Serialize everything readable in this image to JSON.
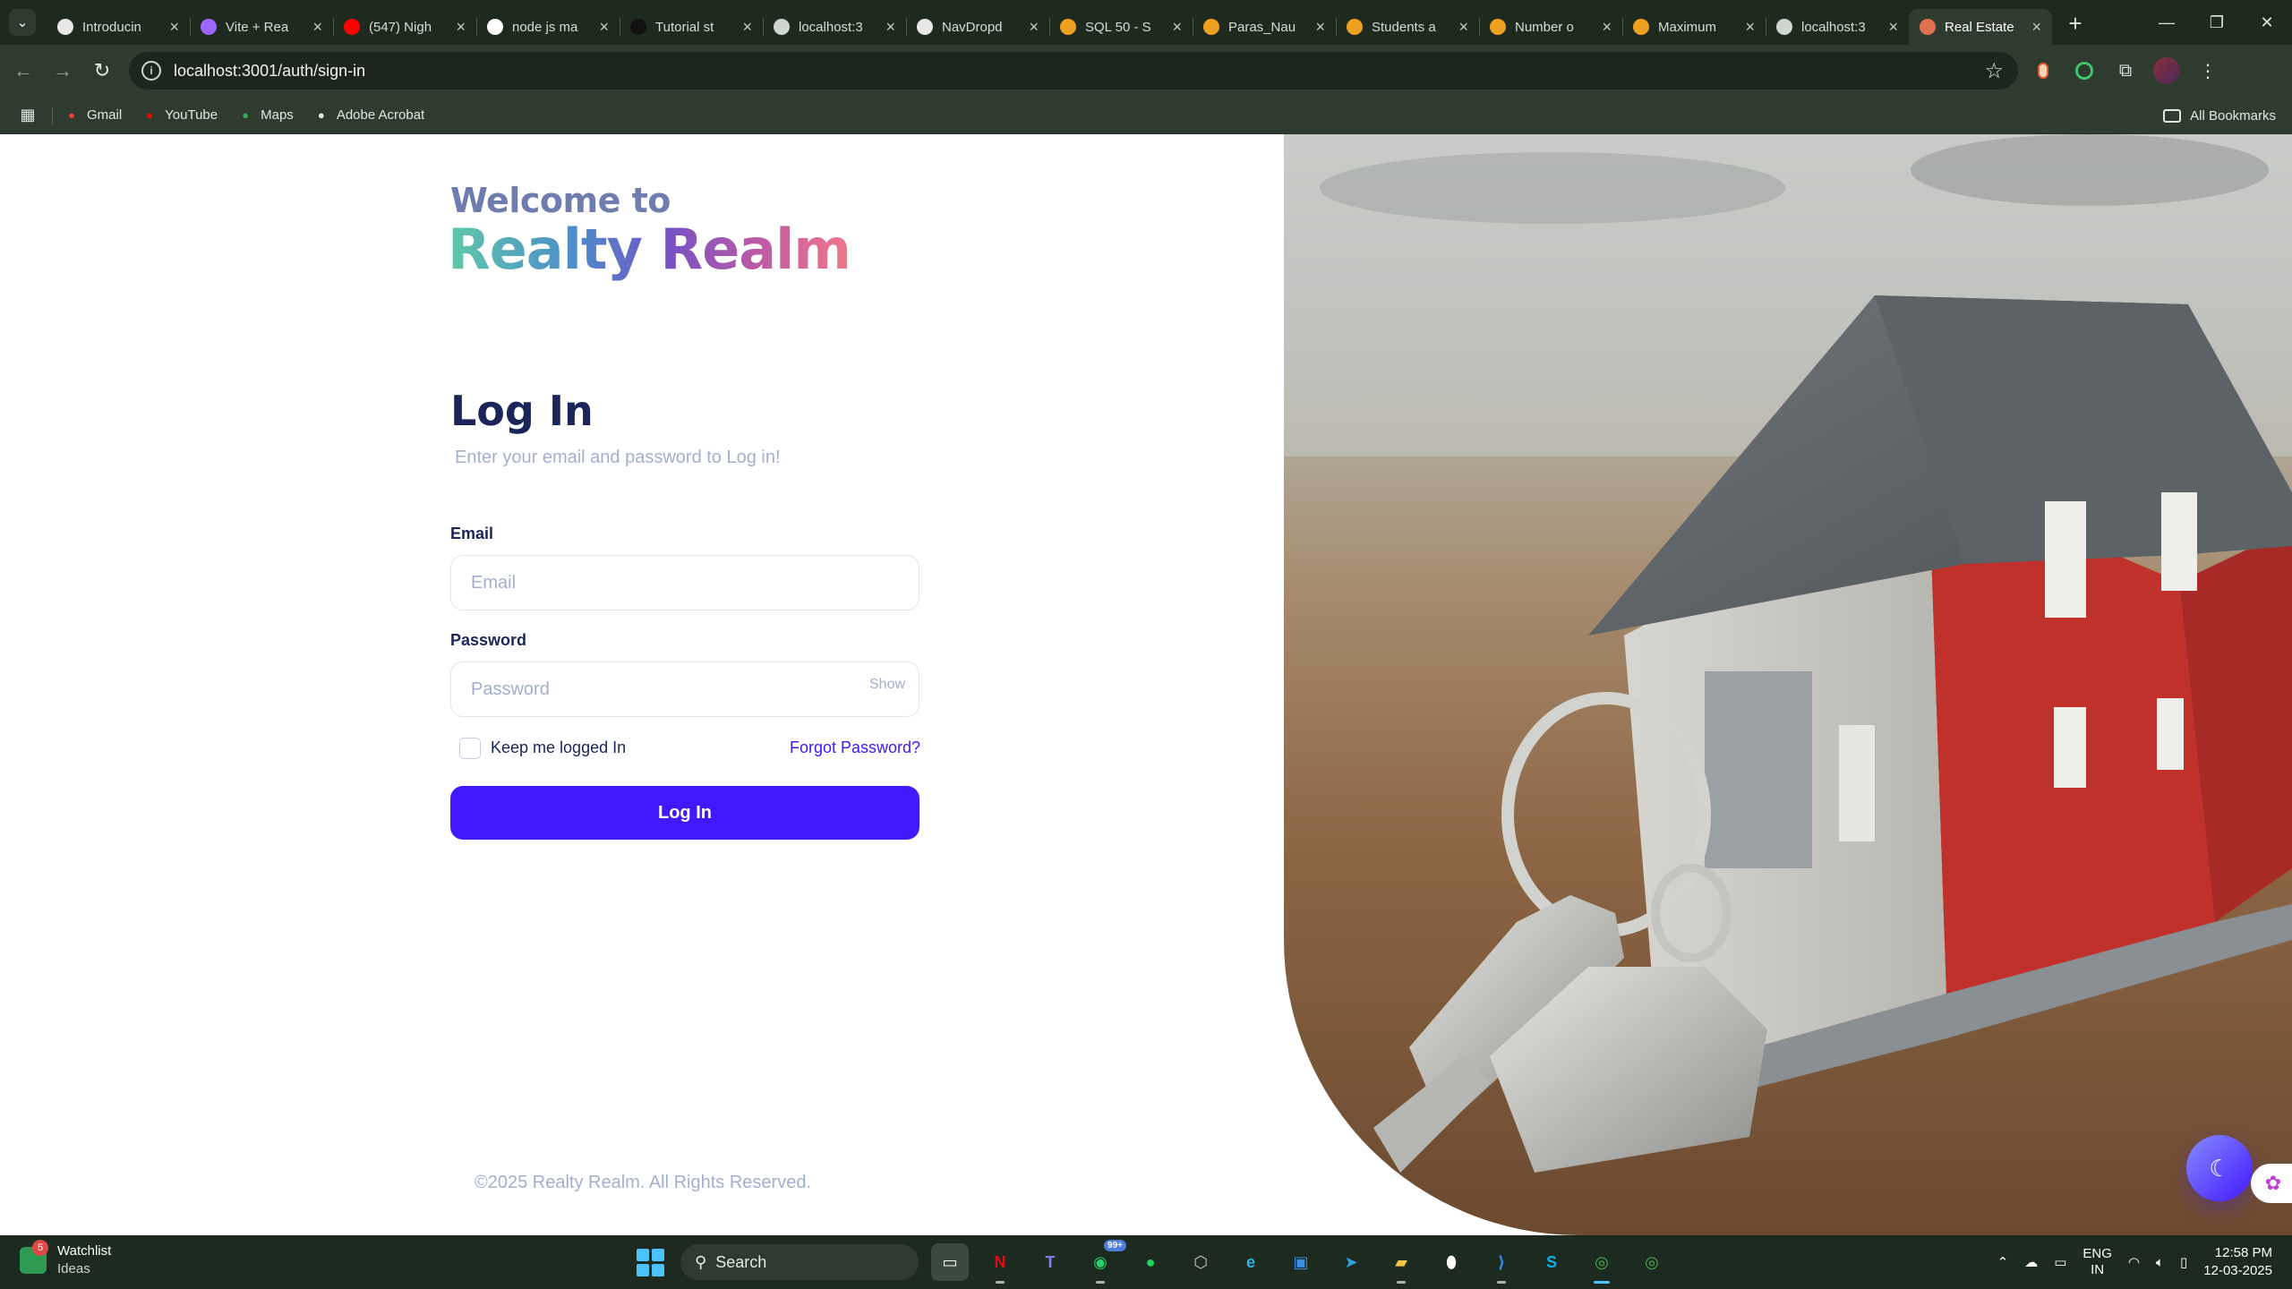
{
  "browser": {
    "tabs": [
      {
        "title": "Introducin",
        "icon": "openai-icon",
        "color": "#e8e8e8"
      },
      {
        "title": "Vite + Rea",
        "icon": "vite-icon",
        "color": "#9f67ff"
      },
      {
        "title": "(547) Nigh",
        "icon": "youtube-icon",
        "color": "#ff0000"
      },
      {
        "title": "node js ma",
        "icon": "google-icon",
        "color": "#ffffff"
      },
      {
        "title": "Tutorial st",
        "icon": "nextjs-icon",
        "color": "#111111"
      },
      {
        "title": "localhost:3",
        "icon": "globe-icon",
        "color": "#cfd5cf"
      },
      {
        "title": "NavDropd",
        "icon": "openai-icon",
        "color": "#e8e8e8"
      },
      {
        "title": "SQL 50 - S",
        "icon": "leetcode-icon",
        "color": "#f0a020"
      },
      {
        "title": "Paras_Nau",
        "icon": "leetcode-icon",
        "color": "#f0a020"
      },
      {
        "title": "Students a",
        "icon": "leetcode-icon",
        "color": "#f0a020"
      },
      {
        "title": "Number o",
        "icon": "leetcode-icon",
        "color": "#f0a020"
      },
      {
        "title": "Maximum",
        "icon": "leetcode-icon",
        "color": "#f0a020"
      },
      {
        "title": "localhost:3",
        "icon": "globe-icon",
        "color": "#cfd5cf"
      },
      {
        "title": "Real Estate",
        "icon": "site-icon",
        "color": "#e07050",
        "active": true
      }
    ],
    "new_tab": "+",
    "url": "localhost:3001/auth/sign-in",
    "bookmarks": [
      {
        "label": "Gmail",
        "icon": "gmail-icon",
        "color": "#ea4335"
      },
      {
        "label": "YouTube",
        "icon": "youtube-icon",
        "color": "#ff0000"
      },
      {
        "label": "Maps",
        "icon": "maps-pin-icon",
        "color": "#34a853"
      },
      {
        "label": "Adobe Acrobat",
        "icon": "globe-icon",
        "color": "#e2e7e2"
      }
    ],
    "all_bookmarks": "All Bookmarks"
  },
  "page": {
    "welcome": "Welcome to",
    "brand": "Realty Realm",
    "title": "Log In",
    "subtitle": "Enter your email and password to Log in!",
    "email_label": "Email",
    "email_placeholder": "Email",
    "email_value": "",
    "password_label": "Password",
    "password_placeholder": "Password",
    "password_value": "",
    "show_label": "Show",
    "keep_logged": "Keep me logged In",
    "keep_checked": false,
    "forgot": "Forgot Password?",
    "submit": "Log In",
    "footer": "©2025 Realty Realm. All Rights Reserved.",
    "accent": "#4318ff",
    "heading_color": "#1b2559",
    "muted_color": "#a3aed0"
  },
  "taskbar": {
    "widget_title": "Watchlist",
    "widget_sub": "Ideas",
    "widget_badge": "5",
    "search_label": "Search",
    "whatsapp_badge": "99+",
    "lang_top": "ENG",
    "lang_bottom": "IN",
    "time": "12:58 PM",
    "date": "12-03-2025"
  }
}
